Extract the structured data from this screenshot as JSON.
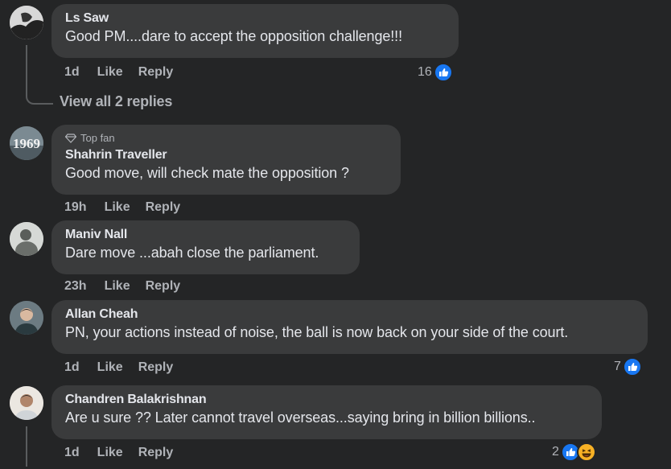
{
  "comments": [
    {
      "author": "Ls Saw",
      "text": "Good PM....dare to accept the opposition challenge!!!",
      "time": "1d",
      "like": "Like",
      "reply": "Reply",
      "reaction_count": "16",
      "reactions": [
        "like-icon"
      ]
    },
    {
      "badge": "Top fan",
      "author": "Shahrin Traveller",
      "text": "Good move, will check mate the opposition ?",
      "time": "19h",
      "like": "Like",
      "reply": "Reply",
      "avatar_text": "1969"
    },
    {
      "author": "Maniv Nall",
      "text": "Dare move ...abah close the parliament.",
      "time": "23h",
      "like": "Like",
      "reply": "Reply"
    },
    {
      "author": "Allan Cheah",
      "text": "PN, your actions instead of noise, the ball is now back on your side of the court.",
      "time": "1d",
      "like": "Like",
      "reply": "Reply",
      "reaction_count": "7",
      "reactions": [
        "like-icon"
      ]
    },
    {
      "author": "Chandren Balakrishnan",
      "text": "Are u sure ?? Later cannot travel overseas...saying bring in billion billions..",
      "time": "1d",
      "like": "Like",
      "reply": "Reply",
      "reaction_count": "2",
      "reactions": [
        "like-icon",
        "haha-icon"
      ]
    }
  ],
  "view_replies": "View all 2 replies",
  "colors": {
    "background": "#242526",
    "bubble": "#3a3b3c",
    "secondary_text": "#b0b3b8",
    "like_blue": "#1877f2",
    "haha_yellow": "#f7b125"
  }
}
